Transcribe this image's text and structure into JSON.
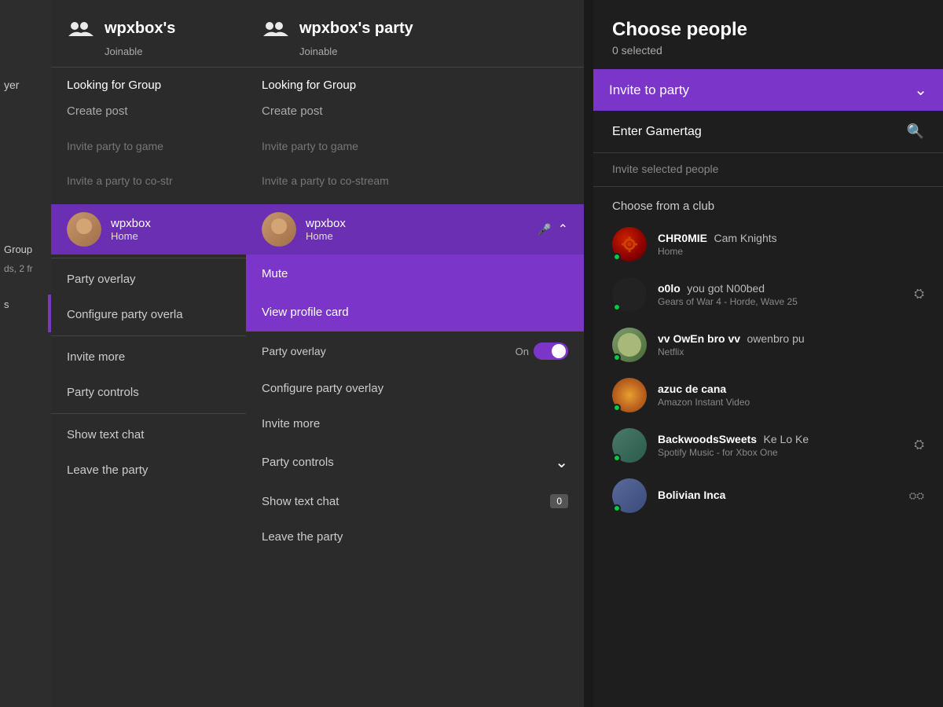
{
  "leftEdge": {
    "partialText1": "yer",
    "partialText2": "Group",
    "partialText3": "ds, 2 fr",
    "partialText4": "s"
  },
  "panel1": {
    "title": "wpxbox's",
    "status": "Joinable",
    "menuItems": [
      {
        "label": "Looking for Group",
        "sub": ""
      },
      {
        "label": "Create post",
        "sub": ""
      },
      {
        "label": "",
        "sub": ""
      },
      {
        "label": "Invite party to game",
        "sub": ""
      },
      {
        "label": "Invite a party to co-str",
        "sub": ""
      }
    ],
    "member": {
      "name": "wpxbox",
      "status": "Home"
    },
    "contextMenu": [
      {
        "label": "Party overlay"
      },
      {
        "label": "Configure party overla"
      },
      {
        "label": ""
      },
      {
        "label": "Invite more"
      },
      {
        "label": "Party controls"
      },
      {
        "label": ""
      },
      {
        "label": "Show text chat"
      },
      {
        "label": "Leave the party"
      }
    ]
  },
  "panel2": {
    "title": "wpxbox's party",
    "status": "Joinable",
    "menuItems": [
      {
        "label": "Looking for Group"
      },
      {
        "label": "Create post"
      },
      {
        "label": ""
      },
      {
        "label": "Invite party to game"
      },
      {
        "label": "Invite a party to co-stream"
      }
    ],
    "member": {
      "name": "wpxbox",
      "status": "Home"
    },
    "mute": "Mute",
    "viewProfile": "View profile card",
    "partyOverlay": "Party overlay",
    "partyOverlayStatus": "On",
    "configureOverlay": "Configure party overlay",
    "inviteMore": "Invite more",
    "partyControls": "Party controls",
    "showTextChat": "Show text chat",
    "textChatCount": "0",
    "leaveParty": "Leave the party"
  },
  "rightPanel": {
    "title": "Choose people",
    "subtitle": "0 selected",
    "inviteDropdown": "Invite to party",
    "enterGamertagLabel": "Enter Gamertag",
    "inviteSelectedLabel": "Invite selected people",
    "chooseFromClub": "Choose from a club",
    "friends": [
      {
        "id": "chromie",
        "name": "CHR0MIE",
        "nameSecondary": "Cam Knights",
        "activity": "Home",
        "avatarClass": "av-chromie",
        "hasGears": true,
        "online": true,
        "icon": ""
      },
      {
        "id": "o0lo",
        "name": "o0lo",
        "nameSecondary": "you got N00bed",
        "activity": "Gears of War 4 - Horde, Wave 25",
        "avatarClass": "av-o0lo",
        "hasGears": false,
        "online": true,
        "icon": "⛭"
      },
      {
        "id": "vvowen",
        "name": "vv OwEn bro vv",
        "nameSecondary": "owenbro pu",
        "activity": "Netflix",
        "avatarClass": "av-vvowen",
        "hasGears": false,
        "online": true,
        "icon": ""
      },
      {
        "id": "azuc",
        "name": "azuc de cana",
        "nameSecondary": "",
        "activity": "Amazon Instant Video",
        "avatarClass": "av-azuc",
        "hasGears": false,
        "online": true,
        "icon": ""
      },
      {
        "id": "backwoods",
        "name": "BackwoodsSweets",
        "nameSecondary": "Ke Lo Ke",
        "activity": "Spotify Music - for Xbox One",
        "avatarClass": "av-backwoods",
        "hasGears": false,
        "online": true,
        "icon": "⛭"
      },
      {
        "id": "bolivian",
        "name": "Bolivian Inca",
        "nameSecondary": "",
        "activity": "",
        "avatarClass": "av-bolivian",
        "hasGears": false,
        "online": true,
        "icon": ""
      }
    ]
  }
}
